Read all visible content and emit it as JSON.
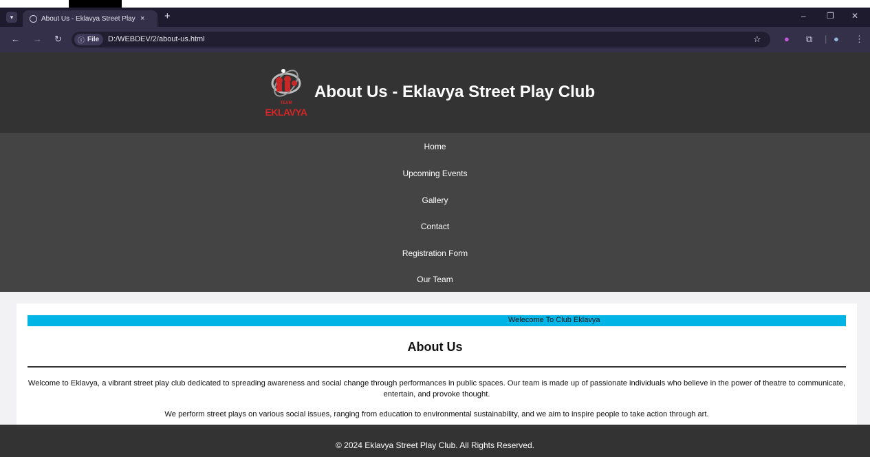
{
  "browser": {
    "tab_title": "About Us - Eklavya Street Play C",
    "tab_close": "×",
    "new_tab": "+",
    "chip_label": "File",
    "url": "D:/WEBDEV/2/about-us.html",
    "win_minimize": "–",
    "win_restore": "❐",
    "win_close": "✕"
  },
  "header": {
    "logo_team": "TEAM",
    "logo_text": "EKLAVYA",
    "title": "About Us - Eklavya Street Play Club"
  },
  "nav": {
    "items": [
      "Home",
      "Upcoming Events",
      "Gallery",
      "Contact",
      "Registration Form",
      "Our Team"
    ]
  },
  "main": {
    "marquee": "Welecome To Club Eklavya",
    "heading": "About Us",
    "paragraph1": "Welcome to Eklavya, a vibrant street play club dedicated to spreading awareness and social change through performances in public spaces. Our team is made up of passionate individuals who believe in the power of theatre to communicate, entertain, and provoke thought.",
    "paragraph2": "We perform street plays on various social issues, ranging from education to environmental sustainability, and we aim to inspire people to take action through art."
  },
  "footer": {
    "text": "© 2024 Eklavya Street Play Club. All Rights Reserved."
  },
  "colors": {
    "header_bg": "#333333",
    "nav_bg": "#444444",
    "marquee_bg": "#00b4e6",
    "browser_tab_bar": "#1f1b2e",
    "browser_toolbar": "#35304a"
  }
}
